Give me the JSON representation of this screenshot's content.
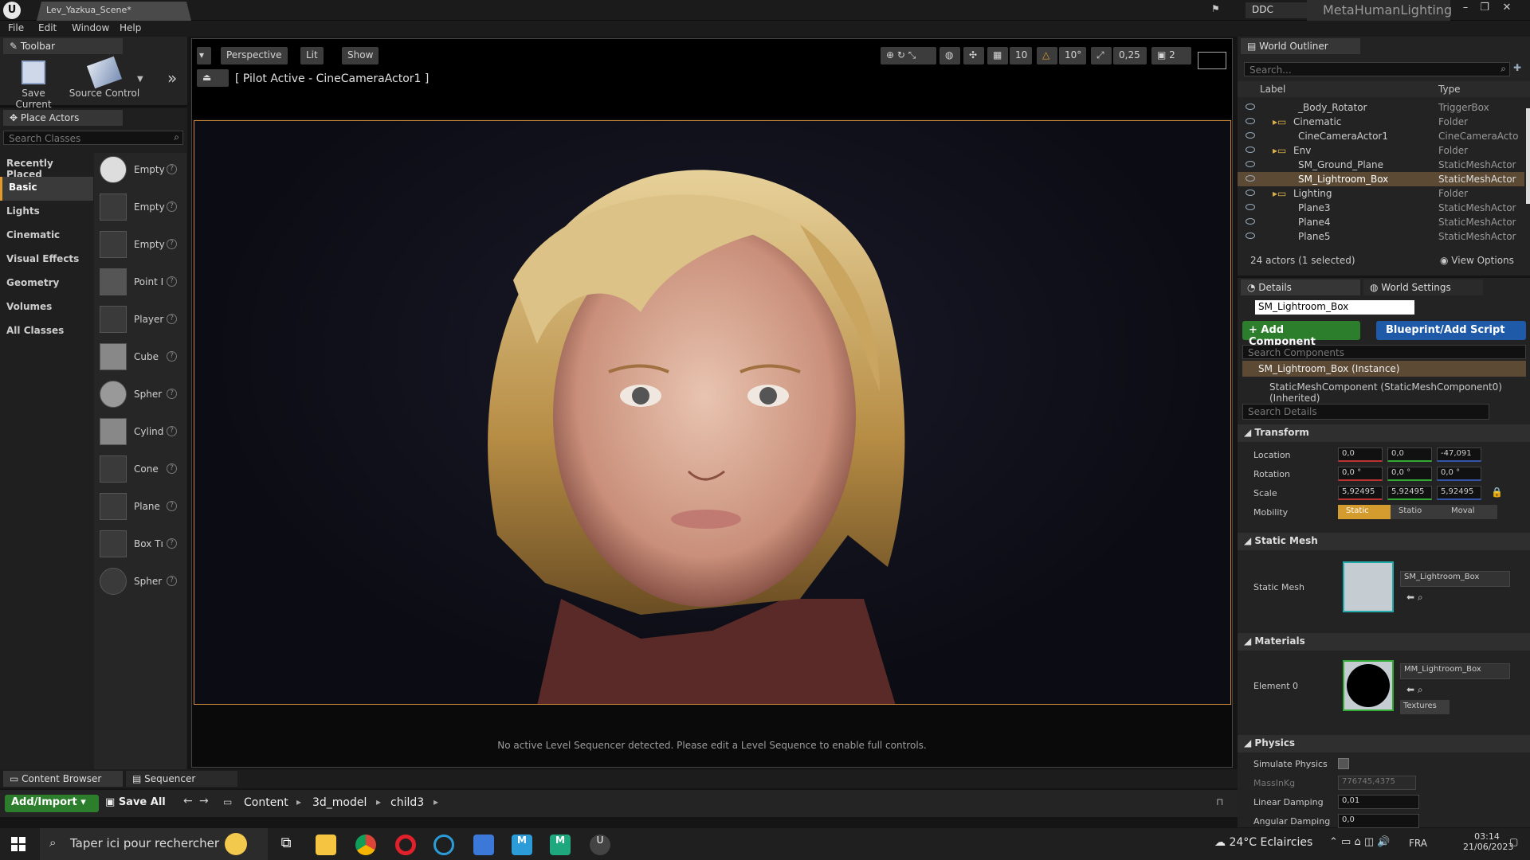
{
  "window": {
    "doc_tab": "Lev_Yazkua_Scene*",
    "ddc_label": "DDC",
    "project_name": "MetaHumanLighting"
  },
  "menu": [
    "File",
    "Edit",
    "Window",
    "Help"
  ],
  "toolbar": {
    "tab_label": "Toolbar",
    "save_current": "Save Current",
    "source_control": "Source Control"
  },
  "place_actors": {
    "tab_label": "Place Actors",
    "search_placeholder": "Search Classes",
    "categories": [
      "Recently Placed",
      "Basic",
      "Lights",
      "Cinematic",
      "Visual Effects",
      "Geometry",
      "Volumes",
      "All Classes"
    ],
    "active_category": "Basic",
    "items": [
      "Empty",
      "Empty",
      "Empty",
      "Point I",
      "Player",
      "Cube",
      "Spher",
      "Cylind",
      "Cone",
      "Plane",
      "Box Tı",
      "Spher"
    ]
  },
  "viewport": {
    "perspective": "Perspective",
    "lit": "Lit",
    "show": "Show",
    "pilot_label": "[ Pilot Active - CineCameraActor1 ]",
    "grid_snap": "10",
    "rot_snap": "10°",
    "scale_snap": "0,25",
    "camera_speed": "2",
    "sequencer_message": "No active Level Sequencer detected. Please edit a Level Sequence to enable full controls."
  },
  "outliner": {
    "tab_label": "World Outliner",
    "search_placeholder": "Search...",
    "col_label": "Label",
    "col_type": "Type",
    "rows": [
      {
        "label": "_Body_Rotator",
        "type": "TriggerBox",
        "indent": 3
      },
      {
        "label": "Cinematic",
        "type": "Folder",
        "indent": 2
      },
      {
        "label": "CineCameraActor1",
        "type": "CineCameraActo",
        "indent": 3
      },
      {
        "label": "Env",
        "type": "Folder",
        "indent": 2
      },
      {
        "label": "SM_Ground_Plane",
        "type": "StaticMeshActor",
        "indent": 3
      },
      {
        "label": "SM_Lightroom_Box",
        "type": "StaticMeshActor",
        "indent": 3,
        "selected": true
      },
      {
        "label": "Lighting",
        "type": "Folder",
        "indent": 2
      },
      {
        "label": "Plane3",
        "type": "StaticMeshActor",
        "indent": 3
      },
      {
        "label": "Plane4",
        "type": "StaticMeshActor",
        "indent": 3
      },
      {
        "label": "Plane5",
        "type": "StaticMeshActor",
        "indent": 3
      }
    ],
    "summary": "24 actors (1 selected)",
    "view_options": "View Options"
  },
  "details": {
    "tab_details": "Details",
    "tab_world": "World Settings",
    "actor_name": "SM_Lightroom_Box",
    "add_component": "+ Add Component",
    "blueprint": "Blueprint/Add Script",
    "search_components": "Search Components",
    "instance": "SM_Lightroom_Box (Instance)",
    "component": "StaticMeshComponent (StaticMeshComponent0) (Inherited)",
    "search_details": "Search Details",
    "transform": {
      "section": "Transform",
      "location_label": "Location",
      "location": [
        "0,0",
        "0,0",
        "-47,091"
      ],
      "rotation_label": "Rotation",
      "rotation": [
        "0,0 °",
        "0,0 °",
        "0,0 °"
      ],
      "scale_label": "Scale",
      "scale": [
        "5,92495",
        "5,92495",
        "5,92495"
      ],
      "mobility_label": "Mobility",
      "mobility": [
        "Static",
        "Statio",
        "Moval"
      ]
    },
    "static_mesh": {
      "section": "Static Mesh",
      "label": "Static Mesh",
      "value": "SM_Lightroom_Box"
    },
    "materials": {
      "section": "Materials",
      "label": "Element 0",
      "value": "MM_Lightroom_Box",
      "textures": "Textures"
    },
    "physics": {
      "section": "Physics",
      "simulate": "Simulate Physics",
      "mass_label": "MassInKg",
      "mass": "776745,4375",
      "linear_label": "Linear Damping",
      "linear": "0,01",
      "angular_label": "Angular Damping",
      "angular": "0,0"
    }
  },
  "content_browser": {
    "tab1": "Content Browser",
    "tab2": "Sequencer",
    "add_import": "Add/Import",
    "save_all": "Save All",
    "breadcrumb": [
      "Content",
      "3d_model",
      "child3"
    ]
  },
  "taskbar": {
    "search_text": "Taper ici pour rechercher",
    "weather": "24°C  Eclaircies",
    "lang": "FRA",
    "time": "03:14",
    "date": "21/06/2023"
  },
  "colors": {
    "accent_orange": "#e19a2b",
    "selection": "#5c4a34",
    "add_green": "#2c7d2c",
    "blueprint_blue": "#1e5aa8"
  }
}
